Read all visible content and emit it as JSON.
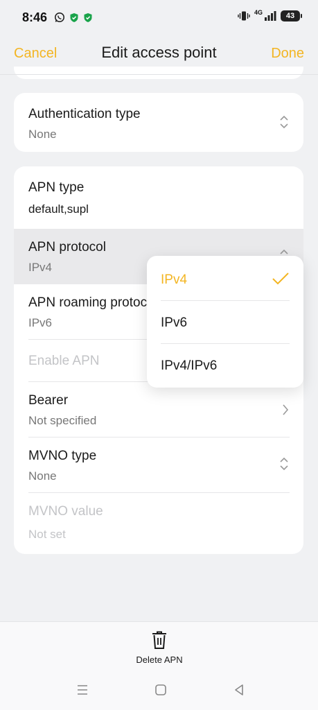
{
  "status_bar": {
    "time": "8:46",
    "network_label": "4G",
    "battery_level": "43",
    "icons": [
      "whatsapp-icon",
      "shield-icon",
      "shield-icon",
      "vibrate-icon",
      "signal-icon",
      "battery-icon"
    ]
  },
  "header": {
    "cancel_label": "Cancel",
    "title": "Edit access point",
    "done_label": "Done"
  },
  "colors": {
    "accent": "#f3b522",
    "background": "#f0f1f3",
    "card": "#ffffff",
    "disabled_text": "#c3c4c7"
  },
  "auth": {
    "title": "Authentication type",
    "value": "None"
  },
  "apn_settings": [
    {
      "title": "APN type",
      "value": "default,supl"
    },
    {
      "title": "APN protocol",
      "value": "IPv4"
    },
    {
      "title": "APN roaming protocol",
      "value": "IPv6"
    },
    {
      "title": "Enable APN",
      "value": ""
    },
    {
      "title": "Bearer",
      "value": "Not specified"
    },
    {
      "title": "MVNO type",
      "value": "None"
    },
    {
      "title": "MVNO value",
      "value": "Not set"
    }
  ],
  "protocol_menu": {
    "options": [
      "IPv4",
      "IPv6",
      "IPv4/IPv6"
    ],
    "selected": "IPv4"
  },
  "bottom": {
    "delete_label": "Delete APN"
  },
  "nav": {
    "icons": [
      "menu-icon",
      "home-icon",
      "back-icon"
    ]
  }
}
